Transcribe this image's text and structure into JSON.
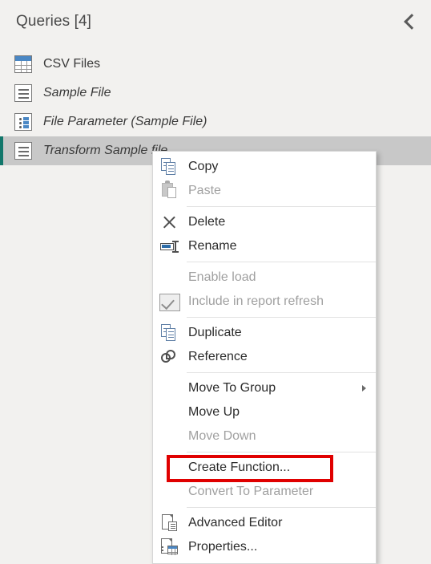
{
  "pane": {
    "title": "Queries [4]",
    "collapse_icon": "chevron-left-icon",
    "accent_color": "#12776b",
    "background_color": "#f2f1ef",
    "selection_color": "#c8c8c8"
  },
  "queries": [
    {
      "label": "CSV Files",
      "icon": "table-icon",
      "italic": false,
      "selected": false
    },
    {
      "label": "Sample File",
      "icon": "lines-doc-icon",
      "italic": true,
      "selected": false
    },
    {
      "label": "File Parameter (Sample File)",
      "icon": "parameter-icon",
      "italic": true,
      "selected": false
    },
    {
      "label": "Transform Sample file",
      "icon": "lines-doc-icon",
      "italic": true,
      "selected": true
    }
  ],
  "context_menu": {
    "highlight_color": "#e00000",
    "highlighted_item": "Create Function...",
    "items": [
      {
        "label": "Copy",
        "icon": "copy-icon",
        "disabled": false,
        "submenu": false,
        "separator_after": false
      },
      {
        "label": "Paste",
        "icon": "paste-icon",
        "disabled": true,
        "submenu": false,
        "separator_after": true
      },
      {
        "label": "Delete",
        "icon": "delete-x-icon",
        "disabled": false,
        "submenu": false,
        "separator_after": false
      },
      {
        "label": "Rename",
        "icon": "rename-icon",
        "disabled": false,
        "submenu": false,
        "separator_after": true
      },
      {
        "label": "Enable load",
        "icon": "none",
        "disabled": true,
        "submenu": false,
        "separator_after": false
      },
      {
        "label": "Include in report refresh",
        "icon": "checkbox-checked-icon",
        "disabled": true,
        "submenu": false,
        "separator_after": true
      },
      {
        "label": "Duplicate",
        "icon": "duplicate-icon",
        "disabled": false,
        "submenu": false,
        "separator_after": false
      },
      {
        "label": "Reference",
        "icon": "reference-link-icon",
        "disabled": false,
        "submenu": false,
        "separator_after": true
      },
      {
        "label": "Move To Group",
        "icon": "none",
        "disabled": false,
        "submenu": true,
        "separator_after": false
      },
      {
        "label": "Move Up",
        "icon": "none",
        "disabled": false,
        "submenu": false,
        "separator_after": false
      },
      {
        "label": "Move Down",
        "icon": "none",
        "disabled": true,
        "submenu": false,
        "separator_after": true
      },
      {
        "label": "Create Function...",
        "icon": "none",
        "disabled": false,
        "submenu": false,
        "separator_after": false,
        "highlighted": true
      },
      {
        "label": "Convert To Parameter",
        "icon": "none",
        "disabled": true,
        "submenu": false,
        "separator_after": true
      },
      {
        "label": "Advanced Editor",
        "icon": "advanced-editor-icon",
        "disabled": false,
        "submenu": false,
        "separator_after": false
      },
      {
        "label": "Properties...",
        "icon": "properties-icon",
        "disabled": false,
        "submenu": false,
        "separator_after": false
      }
    ]
  }
}
